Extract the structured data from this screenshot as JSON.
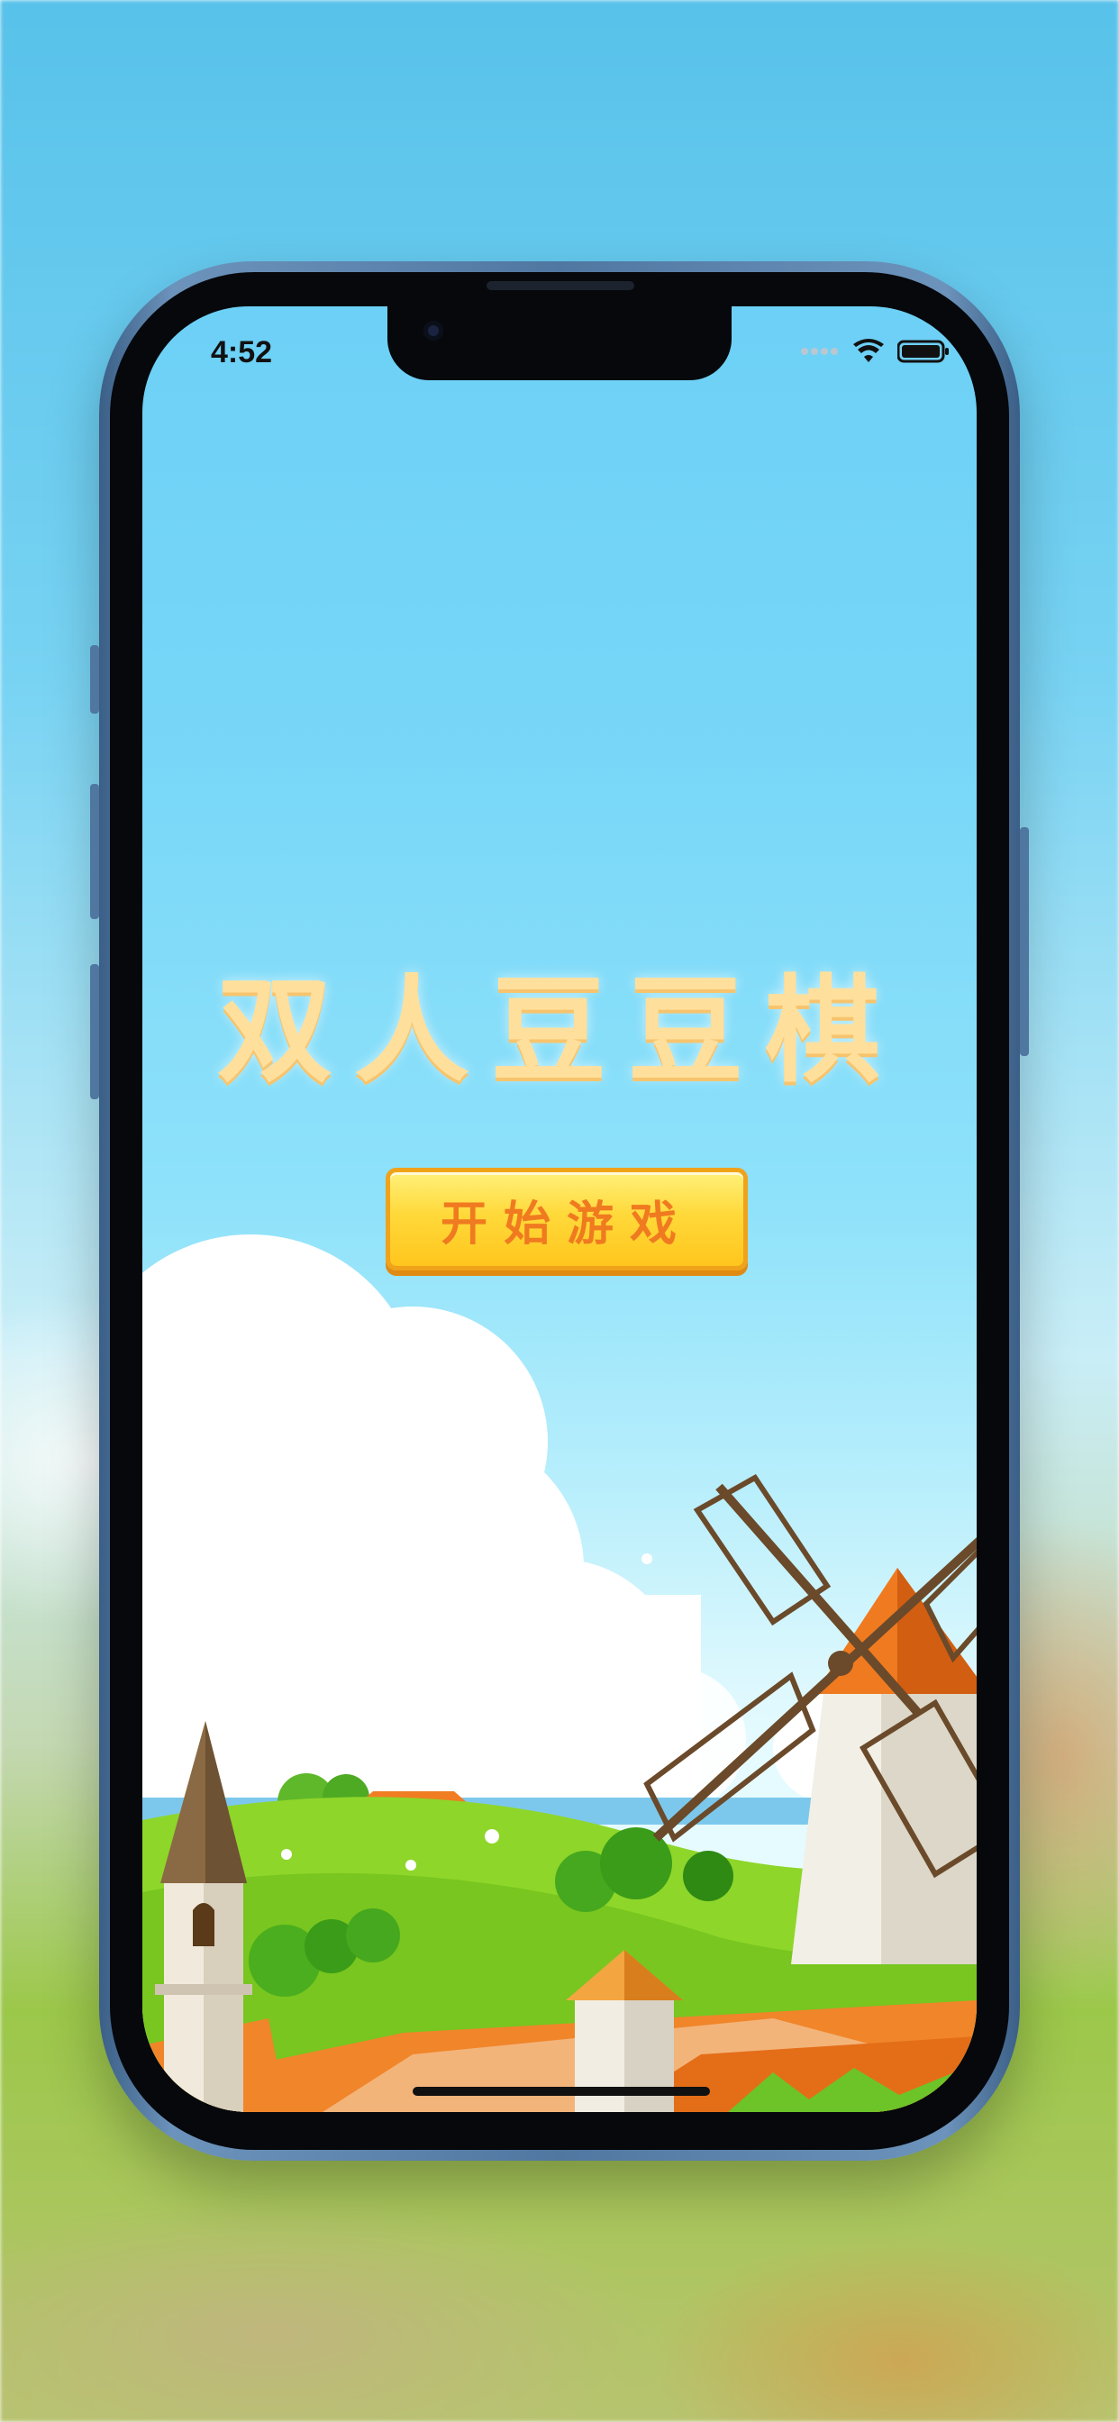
{
  "status_bar": {
    "time": "4:52",
    "signal_icon": "signal-dots-icon",
    "wifi_icon": "wifi-icon",
    "battery_icon": "battery-icon"
  },
  "game": {
    "title": "双人豆豆棋",
    "start_button_label": "开始游戏"
  },
  "colors": {
    "sky_top": "#6dd0f6",
    "title": "#ffdf9c",
    "button_fill": "#ffd93a",
    "button_text": "#f07a20",
    "grass": "#8ed62a"
  }
}
